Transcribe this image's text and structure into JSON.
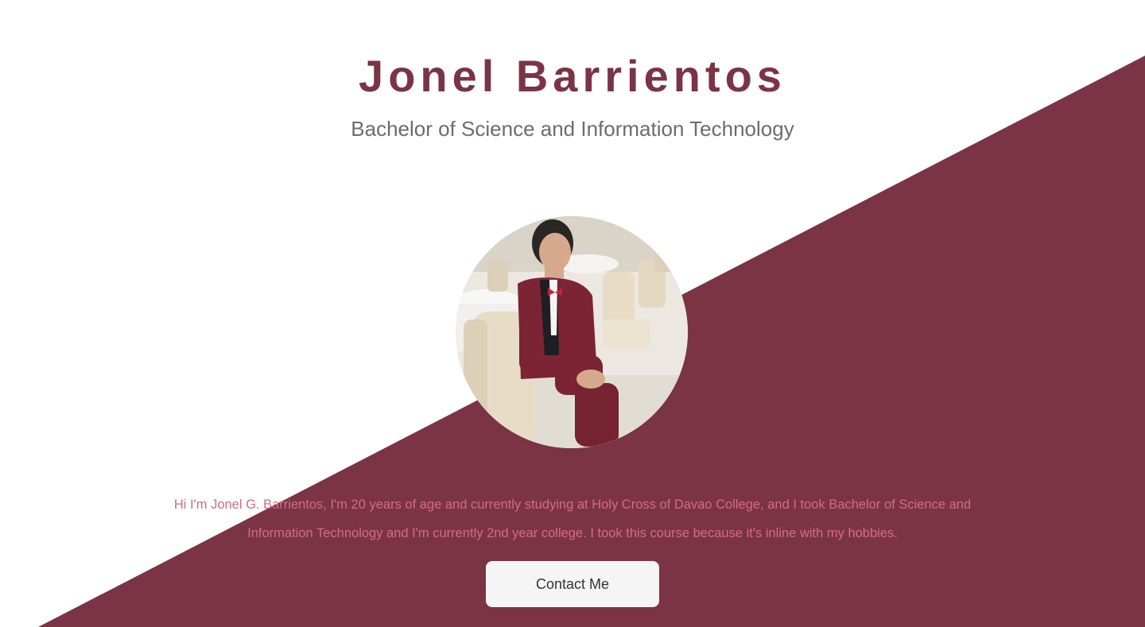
{
  "profile": {
    "name": "Jonel Barrientos",
    "degree": "Bachelor of Science and Information Technology",
    "bio": "Hi I'm Jonel G. Barrientos, I'm 20 years of age and currently studying at Holy Cross of Davao College, and I took Bachelor of Science and Information Technology and I'm currently 2nd year college. I took this course because it's inline with my hobbies.",
    "contact_label": "Contact Me"
  },
  "theme": {
    "accent": "#7a3446",
    "subtitle_color": "#6c6c6c",
    "bio_color": "#d56a86",
    "button_bg": "#f5f5f5"
  }
}
